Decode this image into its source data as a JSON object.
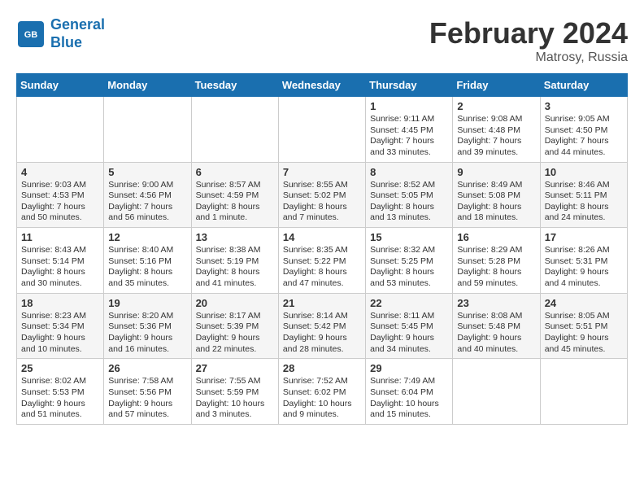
{
  "header": {
    "logo_line1": "General",
    "logo_line2": "Blue",
    "month_year": "February 2024",
    "location": "Matrosy, Russia"
  },
  "days_of_week": [
    "Sunday",
    "Monday",
    "Tuesday",
    "Wednesday",
    "Thursday",
    "Friday",
    "Saturday"
  ],
  "weeks": [
    [
      {
        "day": "",
        "info": ""
      },
      {
        "day": "",
        "info": ""
      },
      {
        "day": "",
        "info": ""
      },
      {
        "day": "",
        "info": ""
      },
      {
        "day": "1",
        "info": "Sunrise: 9:11 AM\nSunset: 4:45 PM\nDaylight: 7 hours\nand 33 minutes."
      },
      {
        "day": "2",
        "info": "Sunrise: 9:08 AM\nSunset: 4:48 PM\nDaylight: 7 hours\nand 39 minutes."
      },
      {
        "day": "3",
        "info": "Sunrise: 9:05 AM\nSunset: 4:50 PM\nDaylight: 7 hours\nand 44 minutes."
      }
    ],
    [
      {
        "day": "4",
        "info": "Sunrise: 9:03 AM\nSunset: 4:53 PM\nDaylight: 7 hours\nand 50 minutes."
      },
      {
        "day": "5",
        "info": "Sunrise: 9:00 AM\nSunset: 4:56 PM\nDaylight: 7 hours\nand 56 minutes."
      },
      {
        "day": "6",
        "info": "Sunrise: 8:57 AM\nSunset: 4:59 PM\nDaylight: 8 hours\nand 1 minute."
      },
      {
        "day": "7",
        "info": "Sunrise: 8:55 AM\nSunset: 5:02 PM\nDaylight: 8 hours\nand 7 minutes."
      },
      {
        "day": "8",
        "info": "Sunrise: 8:52 AM\nSunset: 5:05 PM\nDaylight: 8 hours\nand 13 minutes."
      },
      {
        "day": "9",
        "info": "Sunrise: 8:49 AM\nSunset: 5:08 PM\nDaylight: 8 hours\nand 18 minutes."
      },
      {
        "day": "10",
        "info": "Sunrise: 8:46 AM\nSunset: 5:11 PM\nDaylight: 8 hours\nand 24 minutes."
      }
    ],
    [
      {
        "day": "11",
        "info": "Sunrise: 8:43 AM\nSunset: 5:14 PM\nDaylight: 8 hours\nand 30 minutes."
      },
      {
        "day": "12",
        "info": "Sunrise: 8:40 AM\nSunset: 5:16 PM\nDaylight: 8 hours\nand 35 minutes."
      },
      {
        "day": "13",
        "info": "Sunrise: 8:38 AM\nSunset: 5:19 PM\nDaylight: 8 hours\nand 41 minutes."
      },
      {
        "day": "14",
        "info": "Sunrise: 8:35 AM\nSunset: 5:22 PM\nDaylight: 8 hours\nand 47 minutes."
      },
      {
        "day": "15",
        "info": "Sunrise: 8:32 AM\nSunset: 5:25 PM\nDaylight: 8 hours\nand 53 minutes."
      },
      {
        "day": "16",
        "info": "Sunrise: 8:29 AM\nSunset: 5:28 PM\nDaylight: 8 hours\nand 59 minutes."
      },
      {
        "day": "17",
        "info": "Sunrise: 8:26 AM\nSunset: 5:31 PM\nDaylight: 9 hours\nand 4 minutes."
      }
    ],
    [
      {
        "day": "18",
        "info": "Sunrise: 8:23 AM\nSunset: 5:34 PM\nDaylight: 9 hours\nand 10 minutes."
      },
      {
        "day": "19",
        "info": "Sunrise: 8:20 AM\nSunset: 5:36 PM\nDaylight: 9 hours\nand 16 minutes."
      },
      {
        "day": "20",
        "info": "Sunrise: 8:17 AM\nSunset: 5:39 PM\nDaylight: 9 hours\nand 22 minutes."
      },
      {
        "day": "21",
        "info": "Sunrise: 8:14 AM\nSunset: 5:42 PM\nDaylight: 9 hours\nand 28 minutes."
      },
      {
        "day": "22",
        "info": "Sunrise: 8:11 AM\nSunset: 5:45 PM\nDaylight: 9 hours\nand 34 minutes."
      },
      {
        "day": "23",
        "info": "Sunrise: 8:08 AM\nSunset: 5:48 PM\nDaylight: 9 hours\nand 40 minutes."
      },
      {
        "day": "24",
        "info": "Sunrise: 8:05 AM\nSunset: 5:51 PM\nDaylight: 9 hours\nand 45 minutes."
      }
    ],
    [
      {
        "day": "25",
        "info": "Sunrise: 8:02 AM\nSunset: 5:53 PM\nDaylight: 9 hours\nand 51 minutes."
      },
      {
        "day": "26",
        "info": "Sunrise: 7:58 AM\nSunset: 5:56 PM\nDaylight: 9 hours\nand 57 minutes."
      },
      {
        "day": "27",
        "info": "Sunrise: 7:55 AM\nSunset: 5:59 PM\nDaylight: 10 hours\nand 3 minutes."
      },
      {
        "day": "28",
        "info": "Sunrise: 7:52 AM\nSunset: 6:02 PM\nDaylight: 10 hours\nand 9 minutes."
      },
      {
        "day": "29",
        "info": "Sunrise: 7:49 AM\nSunset: 6:04 PM\nDaylight: 10 hours\nand 15 minutes."
      },
      {
        "day": "",
        "info": ""
      },
      {
        "day": "",
        "info": ""
      }
    ]
  ]
}
